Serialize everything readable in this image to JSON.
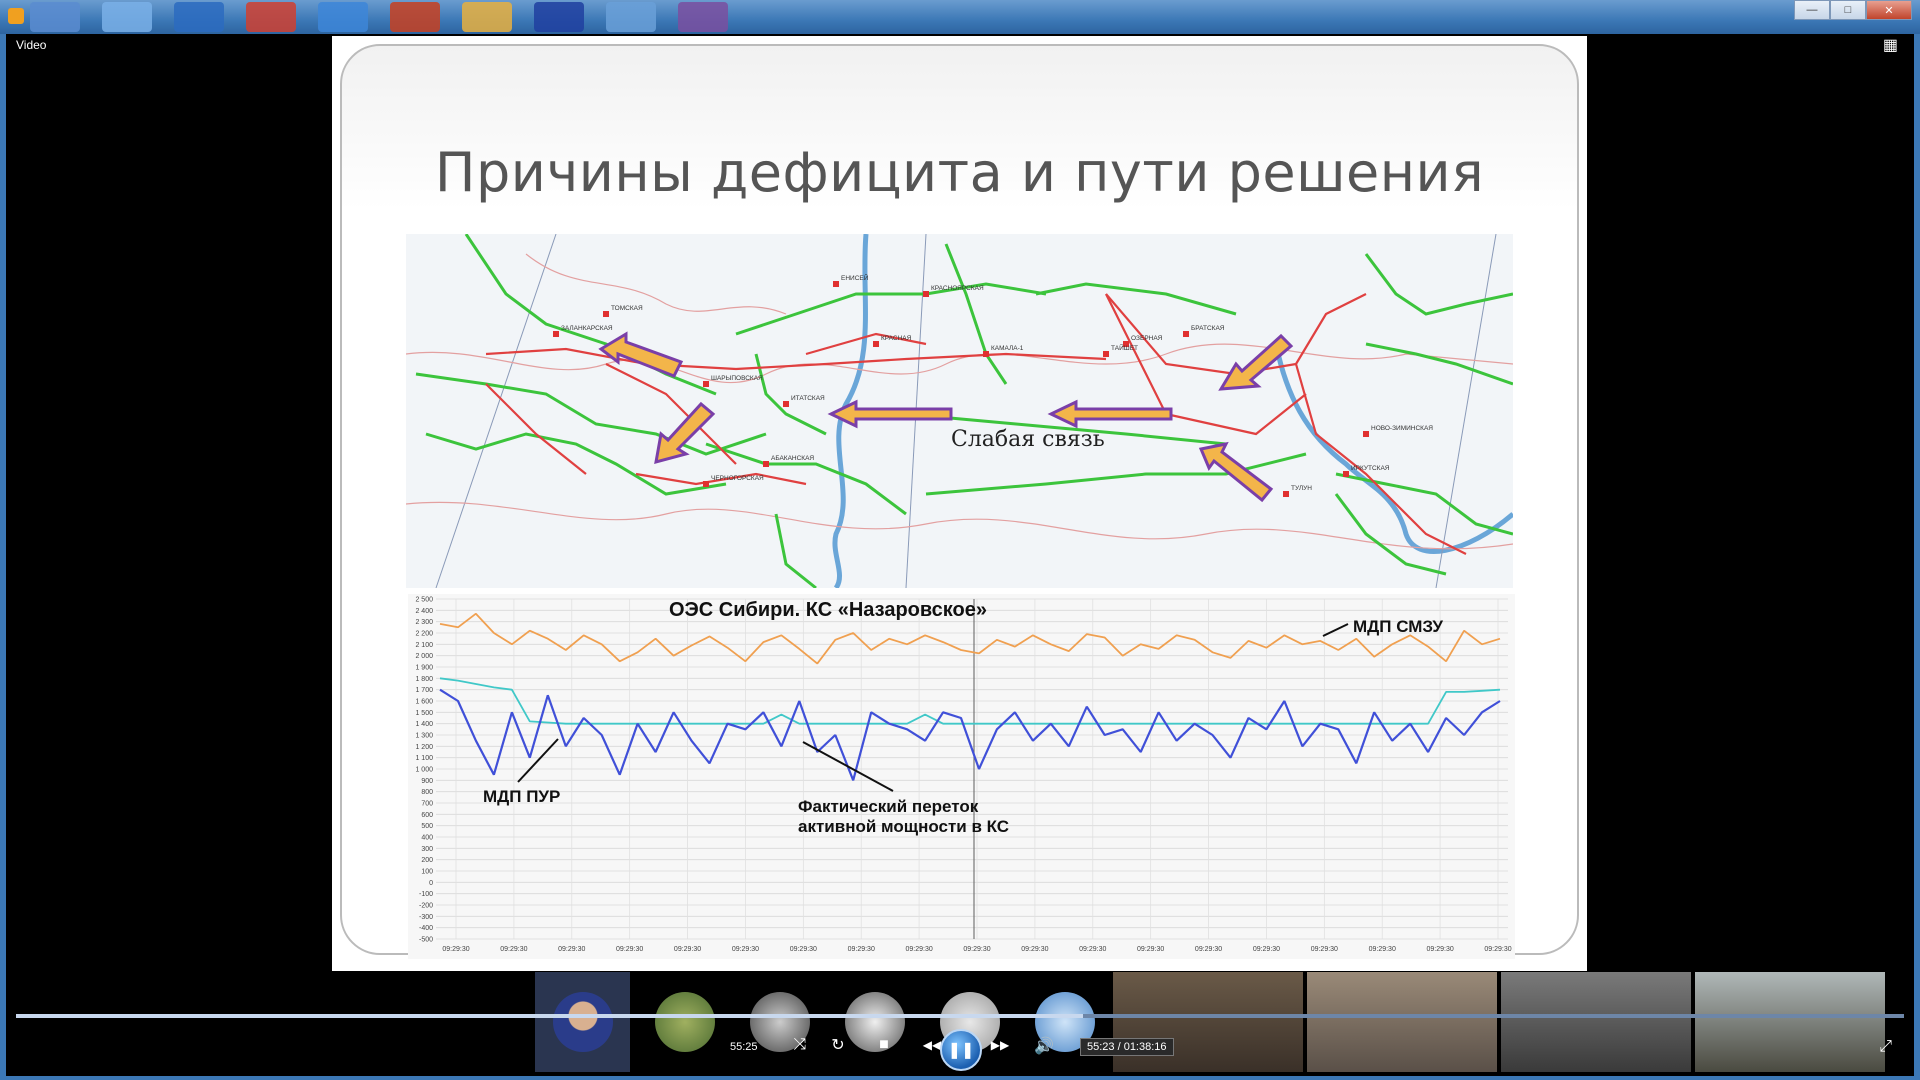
{
  "window": {
    "title_label": "Video",
    "minimize": "—",
    "maximize": "□",
    "close": "✕",
    "taskbar_colors": [
      "#5a8cd0",
      "#7ab0e8",
      "#2c6bbf",
      "#d04030",
      "#3d86d8",
      "#c84020",
      "#e8b040",
      "#2040a0",
      "#6aa0d8",
      "#7a4fa0"
    ]
  },
  "slide": {
    "title": "Причины дефицита и пути решения",
    "map": {
      "weak_link_label": "Слабая связь",
      "node_labels": [
        "ТОМСКАЯ",
        "ЗАЛАНКАРСКАЯ",
        "КРАСНОЯРСКАЯ",
        "КАМАЛА-1",
        "ЕНИСЕЙ",
        "ТАЙШЕТ",
        "ОЗЕРНАЯ",
        "БРАТСКАЯ",
        "ИРКУТСКАЯ",
        "НОВО-ЗИМИНСКАЯ",
        "ТУЛУН",
        "ШАРЫПОВСКАЯ",
        "АБАКАНСКАЯ",
        "КРАСНАЯ",
        "ИТАТСКАЯ",
        "ЧЕРНОГОРСКАЯ"
      ]
    },
    "chart_data": {
      "type": "line",
      "title": "ОЭС Сибири. КС «Назаровское»",
      "ylim": [
        -500,
        2500
      ],
      "y_ticks": [
        "2 500",
        "2 400",
        "2 300",
        "2 200",
        "2 100",
        "2 000",
        "1 900",
        "1 800",
        "1 700",
        "1 600",
        "1 500",
        "1 400",
        "1 300",
        "1 200",
        "1 100",
        "1 000",
        "900",
        "800",
        "700",
        "600",
        "500",
        "400",
        "300",
        "200",
        "100",
        "0",
        "-100",
        "-200",
        "-300",
        "-400",
        "-500"
      ],
      "x_ticks": [
        "09:29:30",
        "09:29:30",
        "09:29:30",
        "09:29:30",
        "09:29:30",
        "09:29:30",
        "09:29:30",
        "09:29:30",
        "09:29:30",
        "09:29:30",
        "09:29:30",
        "09:29:30",
        "09:29:30",
        "09:29:30",
        "09:29:30",
        "09:29:30",
        "09:29:30",
        "09:29:30",
        "09:29:30"
      ],
      "series": [
        {
          "name": "МДП СМЗУ",
          "color": "#f0a050",
          "values": [
            2280,
            2250,
            2370,
            2200,
            2100,
            2220,
            2150,
            2050,
            2180,
            2100,
            1950,
            2030,
            2150,
            2000,
            2090,
            2170,
            2070,
            1950,
            2120,
            2180,
            2060,
            1930,
            2140,
            2200,
            2050,
            2150,
            2100,
            2180,
            2120,
            2050,
            2020,
            2140,
            2080,
            2180,
            2100,
            2040,
            2190,
            2160,
            2000,
            2100,
            2060,
            2180,
            2140,
            2030,
            1980,
            2130,
            2070,
            2180,
            2100,
            2130,
            2050,
            2150,
            1990,
            2100,
            2180,
            2080,
            1950,
            2220,
            2100,
            2150
          ]
        },
        {
          "name": "МДП ПУР",
          "color": "#40c8c8",
          "values": [
            1800,
            1780,
            1750,
            1720,
            1700,
            1420,
            1410,
            1400,
            1400,
            1400,
            1400,
            1400,
            1400,
            1400,
            1400,
            1400,
            1400,
            1400,
            1400,
            1480,
            1400,
            1400,
            1400,
            1400,
            1400,
            1400,
            1400,
            1480,
            1400,
            1400,
            1400,
            1400,
            1400,
            1400,
            1400,
            1400,
            1400,
            1400,
            1400,
            1400,
            1400,
            1400,
            1400,
            1400,
            1400,
            1400,
            1400,
            1400,
            1400,
            1400,
            1400,
            1400,
            1400,
            1400,
            1400,
            1400,
            1680,
            1680,
            1690,
            1700
          ]
        },
        {
          "name": "Фактический переток активной мощности в КС",
          "color": "#4050d8",
          "values": [
            1700,
            1600,
            1250,
            950,
            1500,
            1100,
            1650,
            1200,
            1450,
            1300,
            950,
            1400,
            1150,
            1500,
            1250,
            1050,
            1400,
            1350,
            1500,
            1200,
            1600,
            1150,
            1300,
            900,
            1500,
            1400,
            1350,
            1250,
            1500,
            1450,
            1000,
            1350,
            1500,
            1250,
            1400,
            1200,
            1550,
            1300,
            1350,
            1150,
            1500,
            1250,
            1400,
            1300,
            1100,
            1450,
            1350,
            1600,
            1200,
            1400,
            1350,
            1050,
            1500,
            1250,
            1400,
            1150,
            1450,
            1300,
            1500,
            1600
          ]
        }
      ],
      "annotations": [
        "МДП СМЗУ",
        "МДП ПУР",
        "Фактический переток активной мощности в КС"
      ]
    }
  },
  "player": {
    "current_time": "55:25",
    "time_display": "55:23 / 01:38:16",
    "progress_fraction": 0.565,
    "buttons": {
      "shuffle": "⤨",
      "repeat": "↻",
      "stop": "■",
      "prev": "◀◀",
      "pause": "❚❚",
      "next": "▶▶",
      "volume": "🔊",
      "expand": "⤢",
      "layout": "▦"
    }
  }
}
